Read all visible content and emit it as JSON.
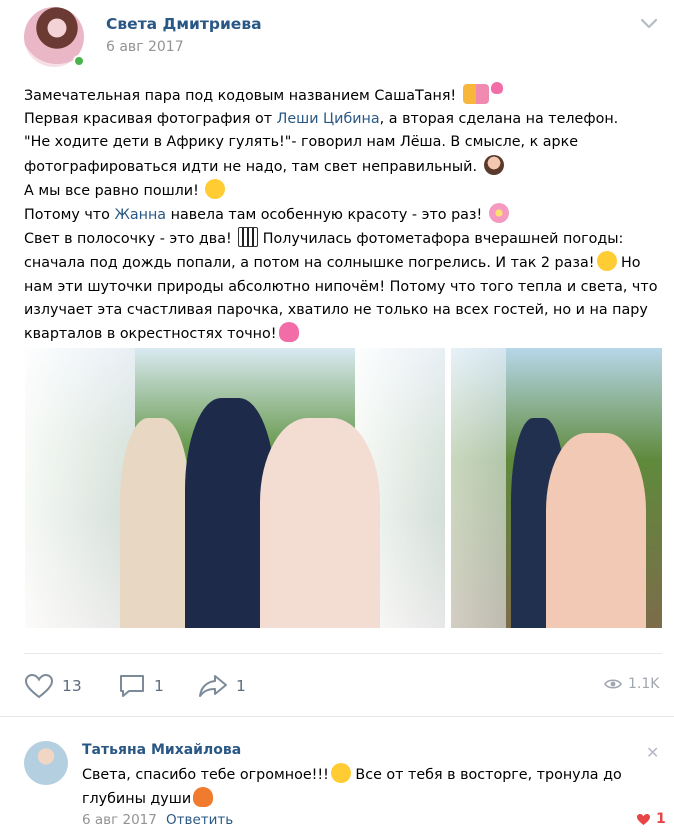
{
  "post": {
    "author": "Света Дмитриева",
    "date": "6 авг 2017",
    "menu_icon": "chevron-down-icon",
    "lines": {
      "l1": "Замечательная пара под кодовым названием СашаТаня!",
      "l2_a": "Первая красивая фотография от ",
      "l2_link": "Леши Цибина",
      "l2_b": ", а вторая сделана на телефон.",
      "l3": "\"Не ходите дети в Африку гулять!\"- говорил нам Лёша. В смысле, к арке",
      "l4": "фотографироваться идти не надо, там свет неправильный.",
      "l5": "А мы все равно пошли!",
      "l6_a": "Потому что ",
      "l6_link": "Жанна",
      "l6_b": " навела там особенную красоту - это раз!",
      "l7_a": "Свет в полосочку - это два!",
      "l7_b": " Получилась фотометафора вчерашней погоды:",
      "l8": "сначала под дождь попали, а потом на солнышке погрелись. И так 2 раза!",
      "l8_b": " Но",
      "l9": "нам эти шуточки природы абсолютно нипочём! Потому что того тепла и света, что",
      "l10": "излучает эта счастливая парочка, хватило не только на всех гостей, но и на пару",
      "l11": "кварталов в окрестностях точно!"
    },
    "likes": "13",
    "comments": "1",
    "shares": "1",
    "views": "1.1K"
  },
  "comment": {
    "author": "Татьяна Михайлова",
    "text_a": "Света, спасибо тебе огромное!!!",
    "text_b": " Все от тебя в восторге, тронула до",
    "text_c": "глубины души",
    "date": "6 авг 2017",
    "reply": "Ответить",
    "likes": "1"
  }
}
